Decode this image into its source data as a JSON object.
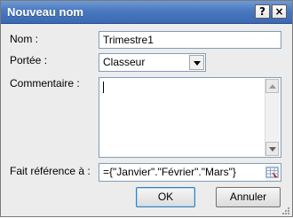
{
  "dialog": {
    "title": "Nouveau nom",
    "help_label": "?",
    "close_label": "×"
  },
  "form": {
    "name_label": "Nom :",
    "name_value": "Trimestre1",
    "scope_label": "Portée :",
    "scope_value": "Classeur",
    "comment_label": "Commentaire :",
    "comment_value": "",
    "refers_label": "Fait référence à :",
    "refers_value": "={\"Janvier\".\"Février\".\"Mars\"}"
  },
  "buttons": {
    "ok_label": "OK",
    "cancel_label": "Annuler"
  },
  "icons": {
    "scope_dropdown": "chevron-down-icon",
    "scroll_up": "scroll-up-icon",
    "scroll_down": "scroll-down-icon",
    "refedit": "collapse-dialog-icon",
    "resize": "resize-grip-icon"
  },
  "colors": {
    "titlebar": "#4a78bf",
    "field_border": "#7f9db9",
    "dialog_bg": "#ececec"
  }
}
